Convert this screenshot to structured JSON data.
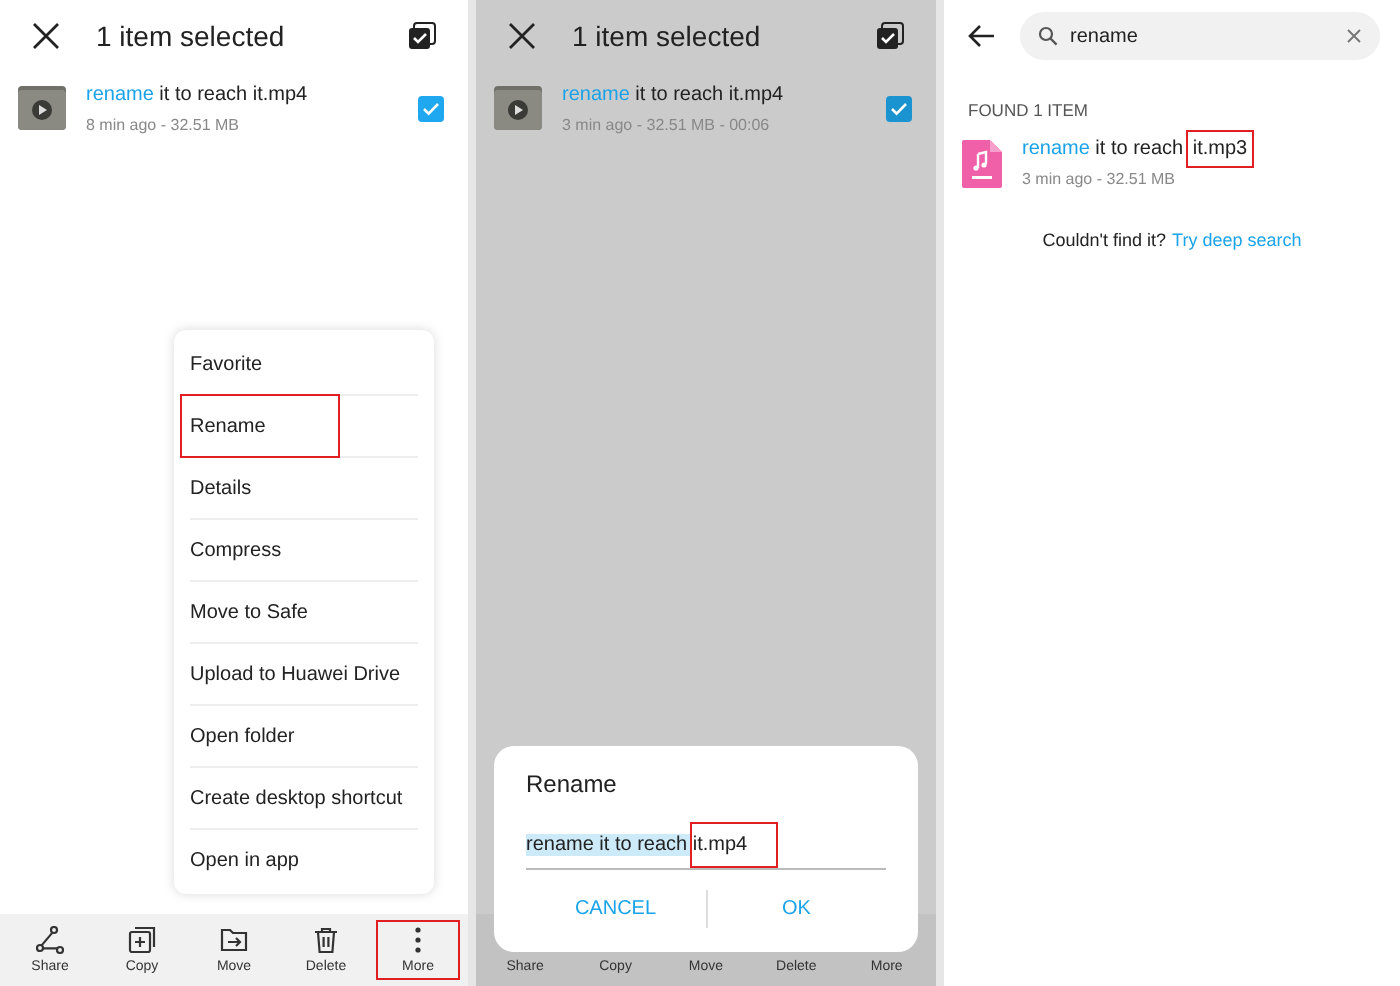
{
  "panels": [
    {
      "kind": "menu",
      "header": {
        "title": "1 item selected"
      },
      "file": {
        "name_parts": [
          {
            "text": "rename",
            "match": true,
            "highlighted": false
          },
          {
            "text": " it to reach it.mp4",
            "match": false,
            "highlighted": false
          }
        ],
        "meta": "8 min ago - 32.51 MB",
        "checked": true
      },
      "menu": [
        {
          "label": "Favorite",
          "highlighted": false
        },
        {
          "label": "Rename",
          "highlighted": true
        },
        {
          "label": "Details",
          "highlighted": false
        },
        {
          "label": "Compress",
          "highlighted": false
        },
        {
          "label": "Move to Safe",
          "highlighted": false
        },
        {
          "label": "Upload to Huawei Drive",
          "highlighted": false
        },
        {
          "label": "Open folder",
          "highlighted": false
        },
        {
          "label": "Create desktop shortcut",
          "highlighted": false
        },
        {
          "label": "Open in app",
          "highlighted": false
        }
      ],
      "toolbar": [
        {
          "kind": "share",
          "label": "Share",
          "highlighted": false
        },
        {
          "kind": "copy",
          "label": "Copy",
          "highlighted": false
        },
        {
          "kind": "move",
          "label": "Move",
          "highlighted": false
        },
        {
          "kind": "delete",
          "label": "Delete",
          "highlighted": false
        },
        {
          "kind": "more",
          "label": "More",
          "highlighted": true
        }
      ]
    },
    {
      "kind": "dialog",
      "header": {
        "title": "1 item selected"
      },
      "file": {
        "name_parts": [
          {
            "text": "rename",
            "match": true,
            "highlighted": false
          },
          {
            "text": " it to reach it.mp4",
            "match": false,
            "highlighted": false
          }
        ],
        "meta": "3 min ago - 32.51 MB - 00:06",
        "checked": true
      },
      "toolbar": [
        {
          "label": "Share"
        },
        {
          "label": "Copy"
        },
        {
          "label": "Move"
        },
        {
          "label": "Delete"
        },
        {
          "label": "More"
        }
      ],
      "dialog": {
        "title": "Rename",
        "value_parts": [
          {
            "text": "rename it to reach ",
            "selected": true,
            "highlighted": false
          },
          {
            "text": "it.mp4",
            "selected": false,
            "highlighted": true
          }
        ],
        "buttons": [
          "CANCEL",
          "OK"
        ]
      }
    },
    {
      "kind": "search",
      "search": {
        "value": "rename"
      },
      "found_label": "FOUND 1 ITEM",
      "file": {
        "name_parts": [
          {
            "text": "rename",
            "match": true,
            "highlighted": false
          },
          {
            "text": " it to reach ",
            "match": false,
            "highlighted": false
          },
          {
            "text": "it.mp3",
            "match": false,
            "highlighted": true
          }
        ],
        "meta": "3 min ago - 32.51 MB"
      },
      "hint": "Couldn't find it?",
      "hint_link": "Try deep search"
    }
  ]
}
